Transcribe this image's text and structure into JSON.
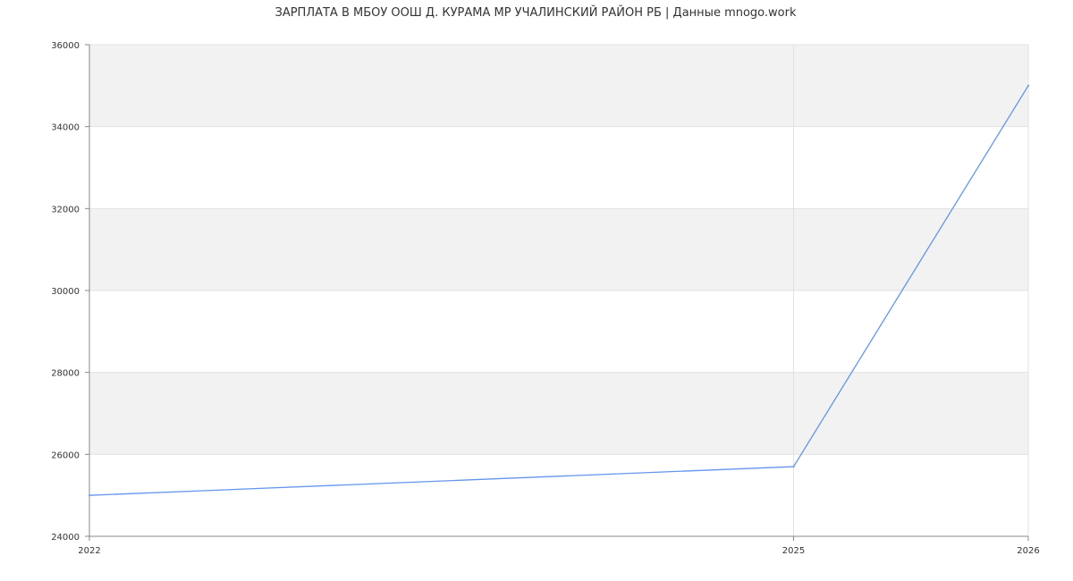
{
  "chart_data": {
    "type": "line",
    "title": "ЗАРПЛАТА В МБОУ ООШ Д. КУРАМА МР УЧАЛИНСКИЙ РАЙОН РБ | Данные mnogo.work",
    "xlabel": "",
    "ylabel": "",
    "x": [
      2022,
      2025,
      2026
    ],
    "x_tick_labels": [
      "2022",
      "2025",
      "2026"
    ],
    "series": [
      {
        "values": [
          25000,
          25700,
          35000
        ]
      }
    ],
    "ylim": [
      24000,
      36000
    ],
    "y_ticks": [
      24000,
      26000,
      28000,
      30000,
      32000,
      34000,
      36000
    ],
    "y_tick_labels": [
      "24000",
      "26000",
      "28000",
      "30000",
      "32000",
      "34000",
      "36000"
    ],
    "grid": true,
    "alternating_bands": true,
    "colors": {
      "line": "#6495ed",
      "band": "#f2f2f2",
      "grid": "#e2e2e2",
      "axis": "#888888"
    }
  }
}
